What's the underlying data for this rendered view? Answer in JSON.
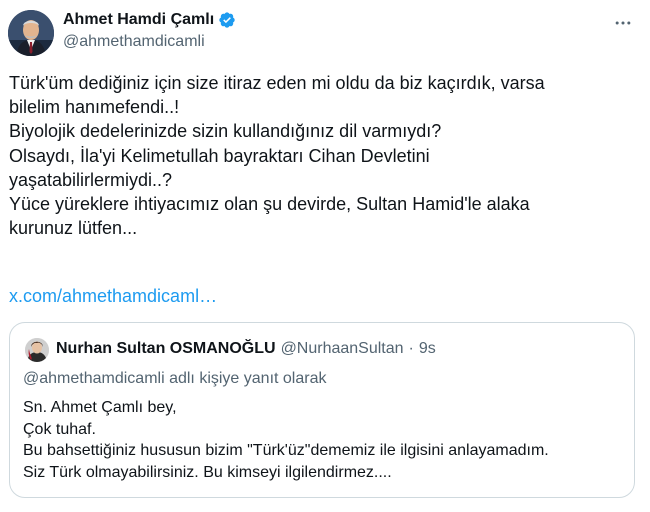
{
  "tweet": {
    "author": {
      "name": "Ahmet Hamdi Çamlı",
      "handle": "@ahmethamdicamli",
      "verified": true,
      "verified_color": "#1d9bf0"
    },
    "body_lines": [
      "Türk'üm dediğiniz için size itiraz eden mi oldu da biz kaçırdık, varsa",
      "bilelim hanımefendi..!",
      "Biyolojik dedelerinizde sizin kullandığınız dil varmıydı?",
      "Olsaydı, İla'yi Kelimetullah bayraktarı  Cihan Devletini",
      "yaşatabilirlermiydi..?",
      "Yüce yüreklere ihtiyacımız olan şu devirde, Sultan Hamid'le alaka",
      "kurunuz lütfen..."
    ],
    "link_text": "x.com/ahmethamdicaml…",
    "more_icon": "more-horizontal-icon"
  },
  "quote": {
    "author": {
      "name": "Nurhan Sultan OSMANOĞLU",
      "handle": "@NurhaanSultan",
      "separator": "·",
      "time": "9s"
    },
    "reply_context": "@ahmethamdicamli adlı kişiye yanıt olarak",
    "body_lines": [
      "Sn. Ahmet Çamlı bey,",
      "Çok tuhaf.",
      "Bu bahsettiğiniz hususun bizim \"Türk'üz\"dememiz ile ilgisini anlayamadım.",
      "Siz Türk olmayabilirsiniz. Bu kimseyi ilgilendirmez...."
    ]
  },
  "colors": {
    "text": "#0f1419",
    "secondary": "#536471",
    "link": "#1d9bf0",
    "border": "#cfd9de"
  }
}
